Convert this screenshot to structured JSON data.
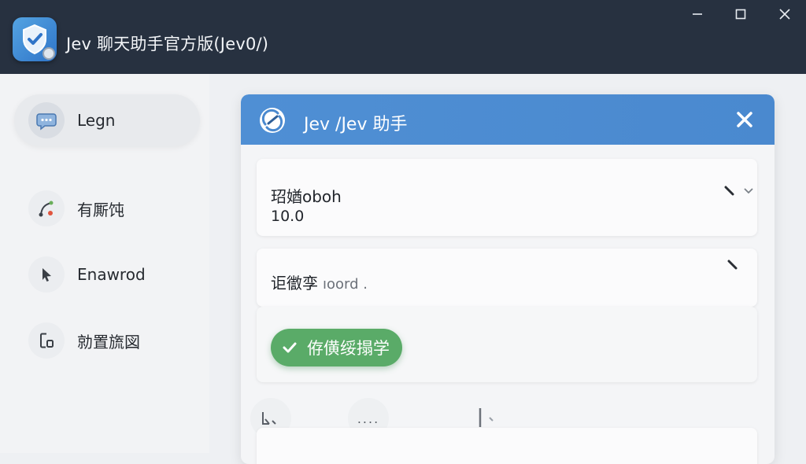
{
  "window": {
    "title": "Jev 聊天助手官方版(Jev0/)",
    "controls": [
      "minimize",
      "maximize",
      "close"
    ]
  },
  "sidebar": {
    "items": [
      {
        "label": "Legn",
        "icon": "chat-bubble-icon",
        "active": true
      },
      {
        "label": "有厮饨",
        "icon": "share-nodes-icon",
        "active": false
      },
      {
        "label": "Enawrod",
        "icon": "cursor-arrow-icon",
        "active": false
      },
      {
        "label": "勍置旒図",
        "icon": "settings-box-icon",
        "active": false
      }
    ]
  },
  "panel": {
    "title": "Jev /Jev 助手",
    "fields": [
      {
        "label": "玿媨oboh",
        "value": "10.0"
      },
      {
        "label": "讵徾孪",
        "value": "ıoord ."
      }
    ],
    "primary_button": {
      "label": "侟僙绥搨学"
    },
    "toolbar": {
      "more_label": "...."
    }
  },
  "colors": {
    "titlebar": "#273140",
    "accent": "#4f8fd4",
    "success": "#5aab68",
    "sidebar": "#f2f3f5"
  }
}
